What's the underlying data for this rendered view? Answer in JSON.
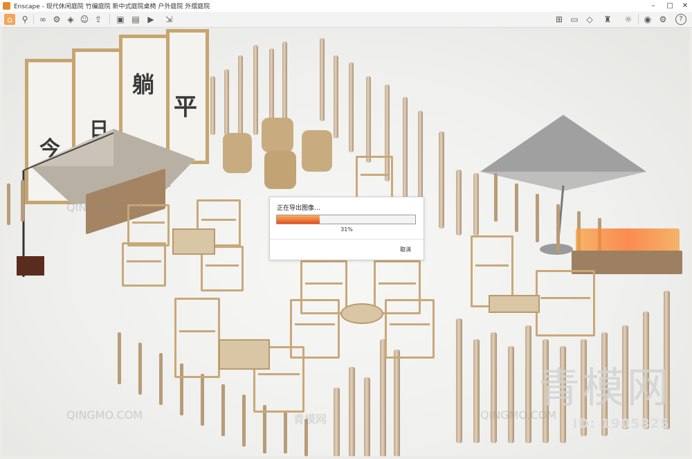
{
  "window": {
    "app_name": "Enscape",
    "title": "Enscape - 现代休闲庭院 竹编庭院 新中式庭院桌椅 户外庭院 外摆庭院",
    "controls": {
      "minimize": "–",
      "maximize": "□",
      "close": "✕"
    }
  },
  "toolbar": {
    "left_icons": [
      "home-icon",
      "pin-icon",
      "binoculars-icon",
      "settings-icon",
      "drop-icon",
      "person-icon",
      "upload-icon",
      "screenshot-icon",
      "panorama-icon",
      "video-icon",
      "export-icon"
    ],
    "right_icons": [
      "map-icon",
      "window-icon",
      "cube-icon",
      "asset-library-icon",
      "sun-icon",
      "view-icon",
      "gear-icon",
      "help-icon"
    ],
    "help_label": "?"
  },
  "dialog": {
    "title": "正在导出图像…",
    "progress_fraction": 0.31,
    "percent_label": "31%",
    "cancel_label": "取消"
  },
  "scene": {
    "screen_chars": [
      "今",
      "日",
      "躺",
      "平"
    ],
    "accent_color": "#f08a2a"
  },
  "watermarks": {
    "site": "QINGMO.COM",
    "site_cn": "青模网",
    "brand_big": "青模网",
    "id_text": "ID: 1905825"
  }
}
